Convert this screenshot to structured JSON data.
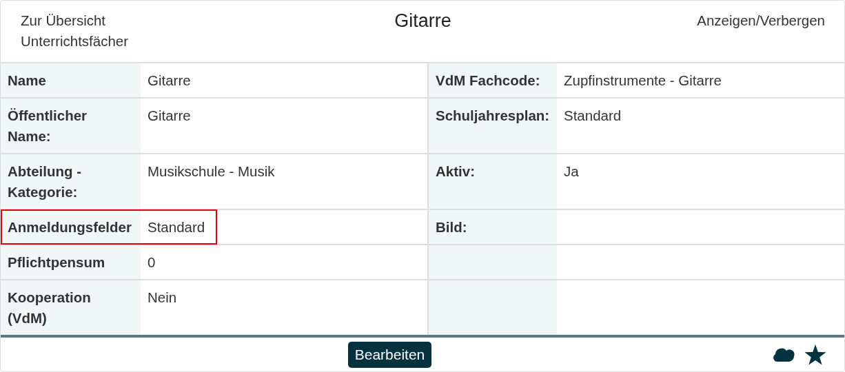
{
  "header": {
    "back_link": "Zur Übersicht Unterrichtsfächer",
    "title": "Gitarre",
    "toggle_link": "Anzeigen/Verbergen"
  },
  "rows": [
    {
      "left": {
        "label": "Name",
        "value": "Gitarre",
        "highlighted": false
      },
      "right": {
        "label": "VdM Fachcode:",
        "value": "Zupfinstrumente - Gitarre"
      }
    },
    {
      "left": {
        "label": "Öffentlicher Name:",
        "value": "Gitarre",
        "highlighted": false
      },
      "right": {
        "label": "Schuljahresplan:",
        "value": "Standard"
      }
    },
    {
      "left": {
        "label": "Abteilung - Kategorie:",
        "value": "Musikschule - Musik",
        "highlighted": false
      },
      "right": {
        "label": "Aktiv:",
        "value": "Ja"
      }
    },
    {
      "left": {
        "label": "Anmeldungsfelder",
        "value": "Standard",
        "highlighted": true
      },
      "right": {
        "label": "Bild:"
      }
    },
    {
      "left": {
        "label": "Pflichtpensum",
        "value": "0",
        "highlighted": false
      }
    },
    {
      "left": {
        "label": "Kooperation (VdM)",
        "value": "Nein",
        "highlighted": false
      }
    }
  ],
  "footer": {
    "button": "Bearbeiten"
  }
}
